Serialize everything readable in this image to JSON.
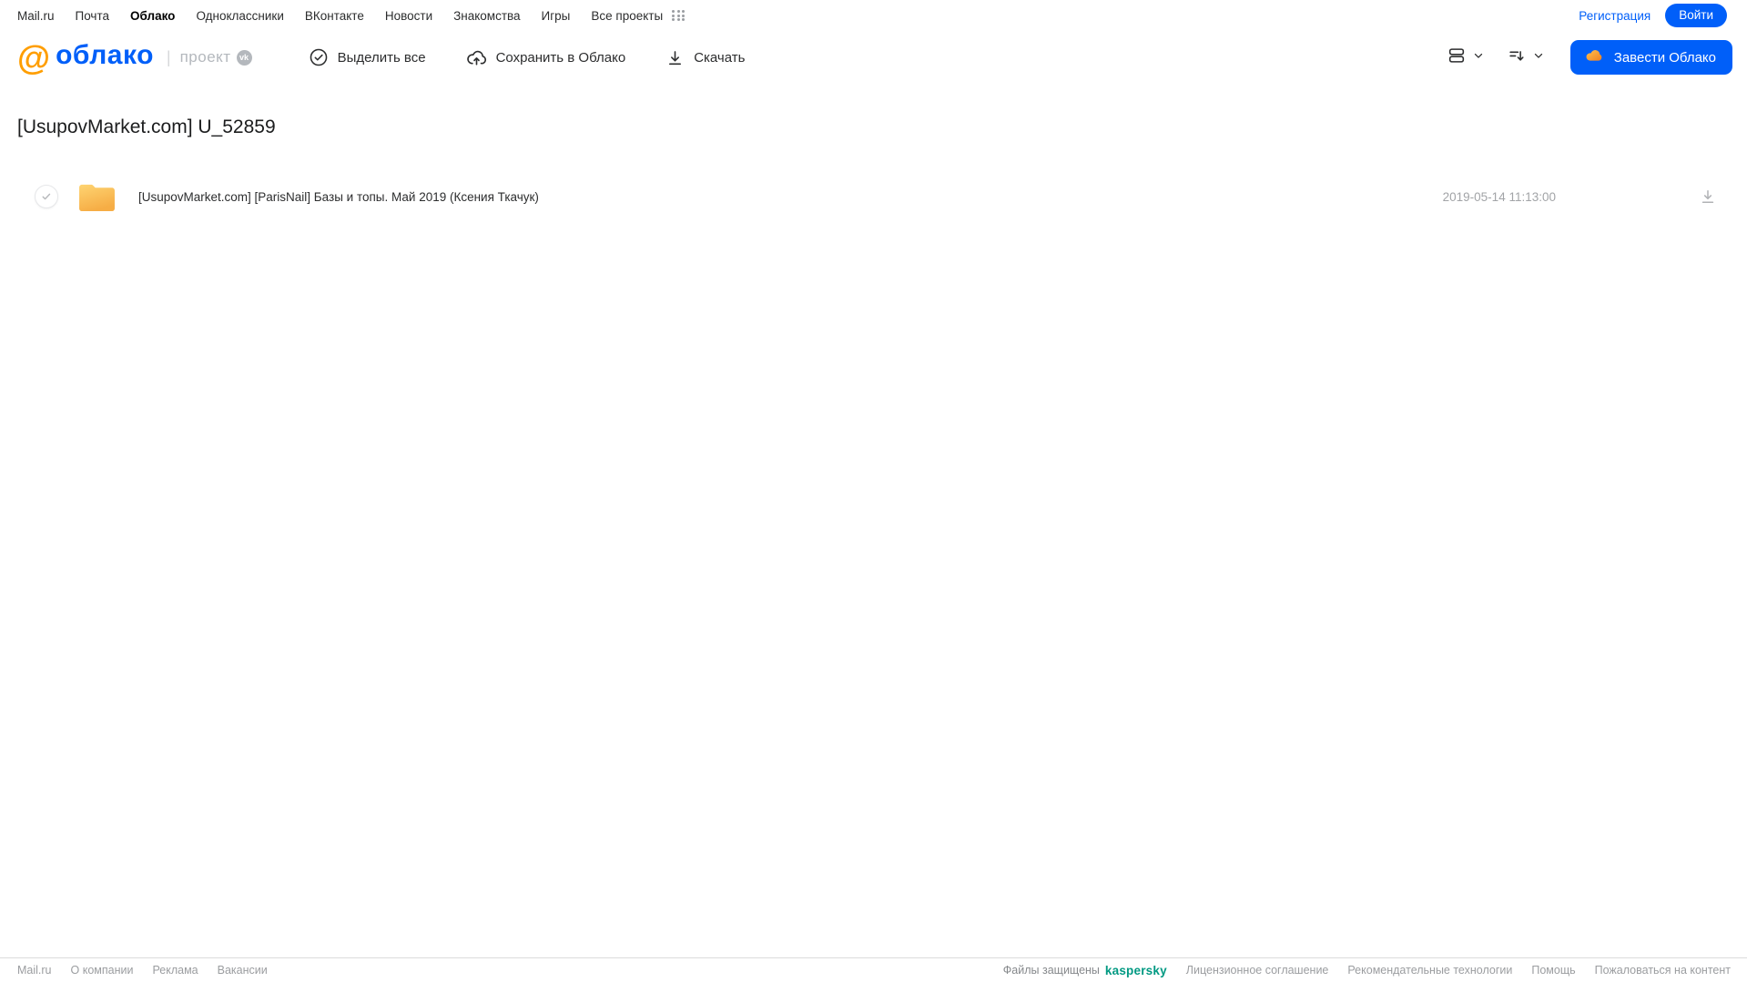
{
  "topnav": {
    "items": [
      {
        "label": "Mail.ru",
        "active": false
      },
      {
        "label": "Почта",
        "active": false
      },
      {
        "label": "Облако",
        "active": true
      },
      {
        "label": "Одноклассники",
        "active": false
      },
      {
        "label": "ВКонтакте",
        "active": false
      },
      {
        "label": "Новости",
        "active": false
      },
      {
        "label": "Знакомства",
        "active": false
      },
      {
        "label": "Игры",
        "active": false
      },
      {
        "label": "Все проекты",
        "active": false
      }
    ],
    "register_label": "Регистрация",
    "login_label": "Войти"
  },
  "header": {
    "at_glyph": "@",
    "brand": "облако",
    "separator": "|",
    "project_label": "проект",
    "vk_badge": "vk",
    "toolbar": {
      "select_all": "Выделить все",
      "save_to_cloud": "Сохранить в Облако",
      "download": "Скачать"
    },
    "create_button": "Завести Облако"
  },
  "page": {
    "title": "[UsupovMarket.com] U_52859"
  },
  "files": [
    {
      "type": "folder",
      "name": "[UsupovMarket.com] [ParisNail] Базы и топы. Май 2019 (Ксения Ткачук)",
      "date": "2019-05-14 11:13:00"
    }
  ],
  "footer": {
    "left_links": [
      "Mail.ru",
      "О компании",
      "Реклама",
      "Вакансии"
    ],
    "protected_text": "Файлы защищены",
    "kaspersky_label": "kaspersky",
    "right_links": [
      "Лицензионное соглашение",
      "Рекомендательные технологии",
      "Помощь",
      "Пожаловаться на контент"
    ]
  },
  "colors": {
    "accent": "#005ff9",
    "brand_orange": "#ff9e00",
    "kaspersky": "#009982",
    "folder_top": "#fed472",
    "folder_bottom": "#f6ad45"
  }
}
